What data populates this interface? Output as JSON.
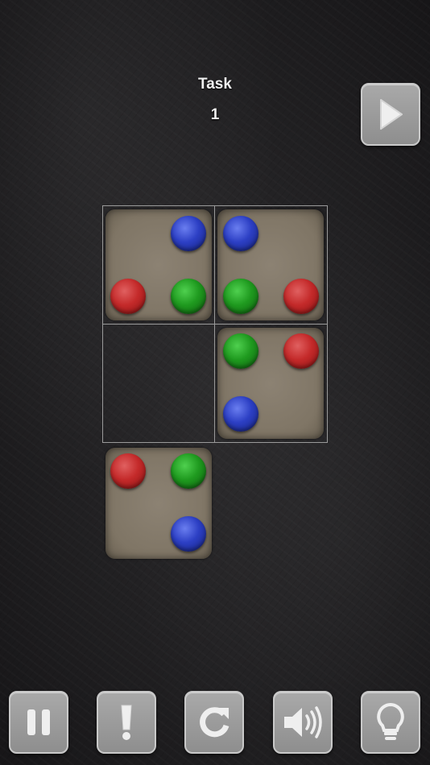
{
  "header": {
    "task_label": "Task",
    "task_number": "1"
  },
  "colors": {
    "red": "#c42a2a",
    "green": "#1f9a1f",
    "blue": "#2c3fc4",
    "tile": "#7f7565",
    "button": "#9c9c9c"
  },
  "board": {
    "rows": 2,
    "cols": 2,
    "tiles": [
      {
        "cell": [
          0,
          0
        ],
        "balls": [
          {
            "pos": "top-right",
            "color": "blue"
          },
          {
            "pos": "bottom-left",
            "color": "red"
          },
          {
            "pos": "bottom-right",
            "color": "green"
          }
        ]
      },
      {
        "cell": [
          0,
          1
        ],
        "balls": [
          {
            "pos": "top-left",
            "color": "blue"
          },
          {
            "pos": "bottom-left",
            "color": "green"
          },
          {
            "pos": "bottom-right",
            "color": "red"
          }
        ]
      },
      {
        "cell": [
          1,
          1
        ],
        "balls": [
          {
            "pos": "top-left",
            "color": "green"
          },
          {
            "pos": "top-right",
            "color": "red"
          },
          {
            "pos": "bottom-left",
            "color": "blue"
          }
        ]
      }
    ],
    "empty_cells": [
      [
        1,
        0
      ]
    ]
  },
  "spare_tile": {
    "balls": [
      {
        "pos": "top-left",
        "color": "red"
      },
      {
        "pos": "top-right",
        "color": "green"
      },
      {
        "pos": "bottom-right",
        "color": "blue"
      }
    ]
  },
  "buttons": {
    "top": [
      "play-icon"
    ],
    "bottom": [
      "pause-icon",
      "exclamation-icon",
      "restart-icon",
      "sound-icon",
      "lightbulb-icon"
    ]
  }
}
